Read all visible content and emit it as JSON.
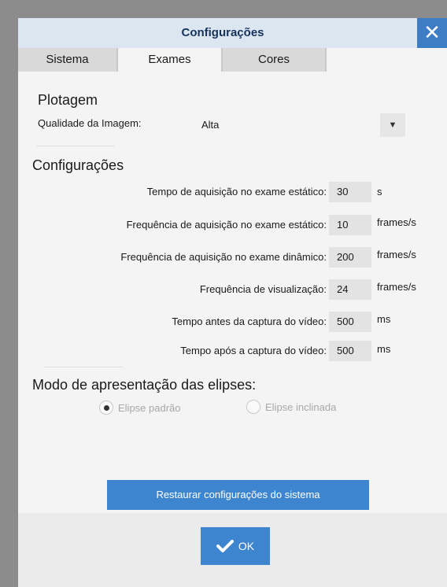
{
  "window": {
    "title": "Configurações",
    "close_icon": "close-icon"
  },
  "tabs": [
    {
      "label": "Sistema",
      "active": false
    },
    {
      "label": "Exames",
      "active": true
    },
    {
      "label": "Cores",
      "active": false
    }
  ],
  "plotagem": {
    "heading": "Plotagem",
    "quality_label": "Qualidade da Imagem:",
    "quality_value": "Alta"
  },
  "config": {
    "heading": "Configurações",
    "rows": [
      {
        "label": "Tempo de aquisição no exame estático:",
        "value": "30",
        "unit": "s"
      },
      {
        "label": "Frequência de aquisição no exame estático:",
        "value": "10",
        "unit": "frames/s"
      },
      {
        "label": "Frequência de aquisição no exame dinâmico:",
        "value": "200",
        "unit": "frames/s"
      },
      {
        "label": "Frequência de visualização:",
        "value": "24",
        "unit": "frames/s"
      },
      {
        "label": "Tempo antes da captura do vídeo:",
        "value": "500",
        "unit": "ms"
      },
      {
        "label": "Tempo após a captura do vídeo:",
        "value": "500",
        "unit": "ms"
      }
    ]
  },
  "ellipse": {
    "heading": "Modo de apresentação das elipses:",
    "options": [
      {
        "label": "Elipse padrão",
        "checked": true
      },
      {
        "label": "Elipse inclinada",
        "checked": false
      }
    ]
  },
  "restore_button": "Restaurar configurações do sistema",
  "ok_button": "OK",
  "colors": {
    "accent": "#3d86cf",
    "title_bar": "#dbe6f0",
    "title_text": "#17335a"
  }
}
